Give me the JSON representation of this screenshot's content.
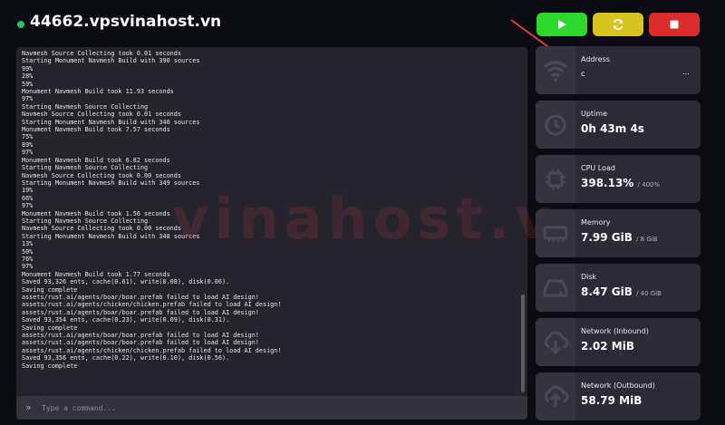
{
  "header": {
    "server_name": "44662.vpsvinahost.vn",
    "status_color": "#22c55e"
  },
  "controls": {
    "start_color": "#2cd82c",
    "restart_color": "#d9c31f",
    "stop_color": "#dc2d2d"
  },
  "console": {
    "lines": [
      "Navmesh Source Collecting took 0.01 seconds",
      "Starting Monument Navmesh Build with 390 sources",
      "99%",
      "28%",
      "59%",
      "Monument Navmesh Build took 11.93 seconds",
      "97%",
      "Starting Navmesh Source Collecting",
      "Navmesh Source Collecting took 0.01 seconds",
      "Starting Monument Navmesh Build with 340 sources",
      "Monument Navmesh Build took 7.57 seconds",
      "75%",
      "89%",
      "97%",
      "Monument Navmesh Build took 6.82 seconds",
      "Starting Navmesh Source Collecting",
      "Navmesh Source Collecting took 0.00 seconds",
      "Starting Monument Navmesh Build with 349 sources",
      "19%",
      "66%",
      "97%",
      "Monument Navmesh Build took 1.56 seconds",
      "Starting Navmesh Source Collecting",
      "Navmesh Source Collecting took 0.00 seconds",
      "Starting Monument Navmesh Build with 348 sources",
      "13%",
      "50%",
      "76%",
      "97%",
      "Monument Navmesh Build took 1.77 seconds",
      "Saved 93,326 ents, cache(0.61), write(0.08), disk(0.06).",
      "Saving complete",
      "assets/rust.ai/agents/boar/boar.prefab failed to load AI design!",
      "assets/rust.ai/agents/chicken/chicken.prefab failed to load AI design!",
      "assets/rust.ai/agents/boar/boar.prefab failed to load AI design!",
      "Saved 93,354 ents, cache(0.23), write(0.09), disk(0.31).",
      "Saving complete",
      "assets/rust.ai/agents/boar/boar.prefab failed to load AI design!",
      "assets/rust.ai/agents/boar/boar.prefab failed to load AI design!",
      "assets/rust.ai/agents/chicken/chicken.prefab failed to load AI design!",
      "Saved 93,356 ents, cache(0.22), write(0.10), disk(0.56).",
      "Saving complete"
    ],
    "command_placeholder": "Type a command...",
    "prompt_glyph": "»"
  },
  "watermark": {
    "text": "vinahost.v"
  },
  "stats": {
    "address": {
      "label": "Address",
      "value": "c",
      "more": "..."
    },
    "uptime": {
      "label": "Uptime",
      "value": "0h 43m 4s"
    },
    "cpu": {
      "label": "CPU Load",
      "value": "398.13%",
      "limit": "/ 400%"
    },
    "memory": {
      "label": "Memory",
      "value": "7.99 GiB",
      "limit": "/ 8 GiB"
    },
    "disk": {
      "label": "Disk",
      "value": "8.47 GiB",
      "limit": "/ 40 GiB"
    },
    "net_in": {
      "label": "Network (Inbound)",
      "value": "2.02 MiB"
    },
    "net_out": {
      "label": "Network (Outbound)",
      "value": "58.79 MiB"
    }
  }
}
